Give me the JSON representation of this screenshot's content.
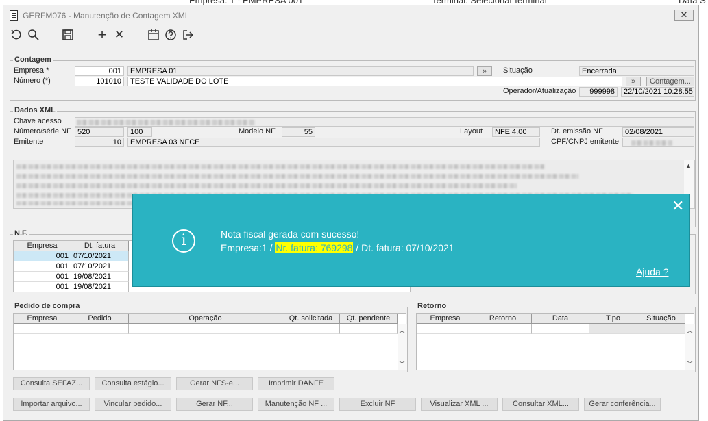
{
  "background": {
    "empresa_text": "Empresa: 1 - EMPRESA 001",
    "terminal_text": "Terminal: Selecionar terminal",
    "data_text": "Data S"
  },
  "window": {
    "title": "GERFM076 - Manutenção de Contagem XML",
    "close_glyph": "✕"
  },
  "toolbar": {
    "undo_icon": "undo-icon",
    "search_icon": "search-icon",
    "save_icon": "save-icon",
    "add_glyph": "+",
    "delete_glyph": "✕",
    "calendar_icon": "calendar-icon",
    "help_icon": "help-icon",
    "exit_icon": "exit-icon"
  },
  "contagem": {
    "title": "Contagem",
    "empresa_label": "Empresa *",
    "empresa_code": "001",
    "empresa_name": "EMPRESA 01",
    "numero_label": "Número (*)",
    "numero_value": "101010",
    "numero_desc": "TESTE VALIDADE DO LOTE",
    "situacao_label": "Situação",
    "situacao_value": "Encerrada",
    "contagem_button": "Contagem...",
    "operador_label": "Operador/Atualização",
    "operador_value": "999998",
    "atualizacao_value": "22/10/2021 10:28:55"
  },
  "dados_xml": {
    "title": "Dados XML",
    "chave_label": "Chave acesso",
    "numero_serie_label": "Número/série NF",
    "numero_nf": "520",
    "serie_nf": "100",
    "modelo_label": "Modelo NF",
    "modelo_value": "55",
    "layout_label": "Layout",
    "layout_value": "NFE 4.00",
    "emissao_label": "Dt. emissão NF",
    "emissao_value": "02/08/2021",
    "emitente_label": "Emitente",
    "emitente_code": "10",
    "emitente_name": "EMPRESA 03 NFCE",
    "cpf_label": "CPF/CNPJ emitente"
  },
  "nf": {
    "title": "N.F.",
    "headers": [
      "Empresa",
      "Dt. fatura"
    ],
    "rows": [
      [
        "001",
        "07/10/2021"
      ],
      [
        "001",
        "07/10/2021"
      ],
      [
        "001",
        "19/08/2021"
      ],
      [
        "001",
        "19/08/2021"
      ]
    ]
  },
  "pedido": {
    "title": "Pedido de compra",
    "headers": [
      "Empresa",
      "Pedido",
      "Operação",
      "Qt. solicitada",
      "Qt. pendente"
    ]
  },
  "retorno": {
    "title": "Retorno",
    "headers": [
      "Empresa",
      "Retorno",
      "Data",
      "Tipo",
      "Situação"
    ]
  },
  "actions_row1": [
    "Consulta SEFAZ...",
    "Consulta estágio...",
    "Gerar NFS-e...",
    "Imprimir DANFE"
  ],
  "actions_row2": [
    "Importar arquivo...",
    "Vincular pedido...",
    "Gerar NF...",
    "Manutenção NF ...",
    "Excluir NF",
    "Visualizar XML ...",
    "Consultar XML...",
    "Gerar conferência..."
  ],
  "popup": {
    "message_line1": "Nota fiscal gerada com sucesso!",
    "empresa_part": "Empresa:1 / ",
    "fatura_part": "Nr. fatura: 769298",
    "dt_part": " / Dt. fatura: 07/10/2021",
    "help_link": "Ajuda ?",
    "close_glyph": "✕",
    "info_glyph": "i"
  }
}
